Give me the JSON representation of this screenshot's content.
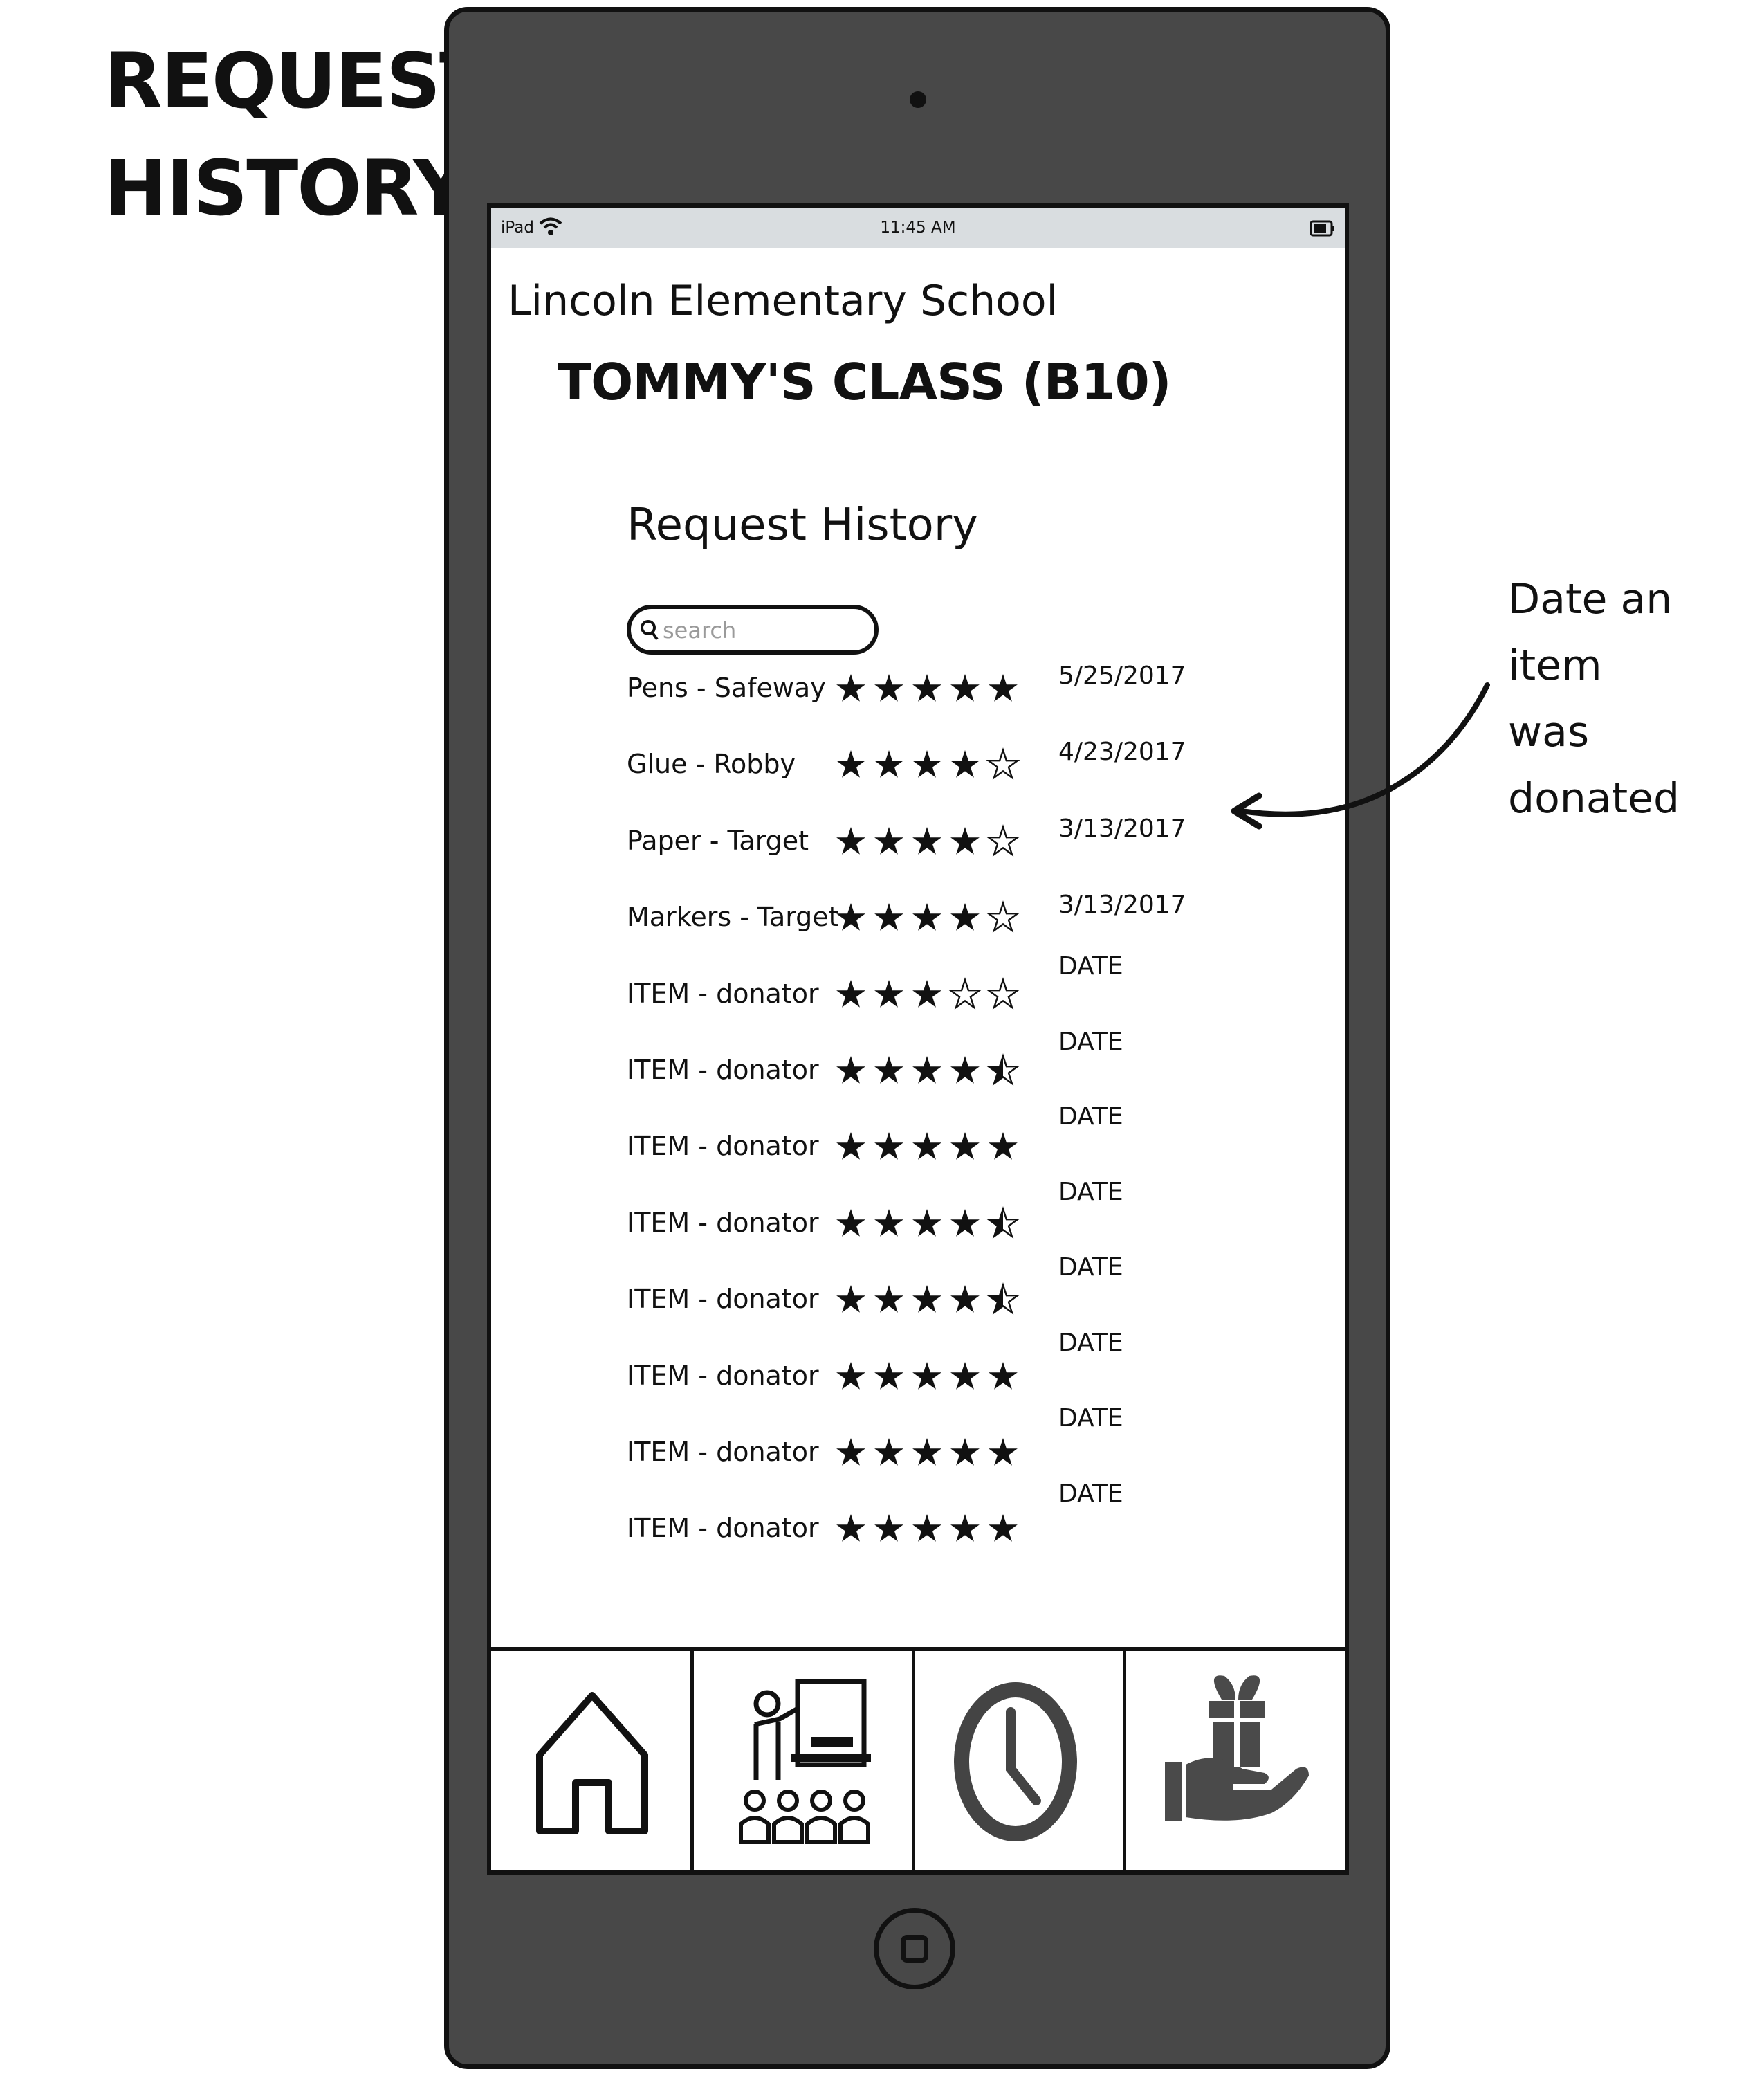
{
  "page_title": {
    "line1": "REQUEST",
    "line2": "HISTORY"
  },
  "status_bar": {
    "carrier": "iPad",
    "time": "11:45 AM"
  },
  "school_name": "Lincoln Elementary School",
  "class_name": "TOMMY'S CLASS (B10)",
  "section_title": "Request History",
  "search": {
    "placeholder": "search",
    "value": ""
  },
  "requests": [
    {
      "label": "Pens - Safeway",
      "rating": 5,
      "date": "5/25/2017"
    },
    {
      "label": "Glue - Robby",
      "rating": 4,
      "date": "4/23/2017"
    },
    {
      "label": "Paper - Target",
      "rating": 4,
      "date": "3/13/2017"
    },
    {
      "label": "Markers - Target",
      "rating": 4,
      "date": "3/13/2017"
    },
    {
      "label": "ITEM - donator",
      "rating": 3,
      "date": "DATE"
    },
    {
      "label": "ITEM - donator",
      "rating": 4.5,
      "date": "DATE"
    },
    {
      "label": "ITEM - donator",
      "rating": 5,
      "date": "DATE"
    },
    {
      "label": "ITEM - donator",
      "rating": 4.5,
      "date": "DATE"
    },
    {
      "label": "ITEM - donator",
      "rating": 4.5,
      "date": "DATE"
    },
    {
      "label": "ITEM - donator",
      "rating": 5,
      "date": "DATE"
    },
    {
      "label": "ITEM - donator",
      "rating": 5,
      "date": "DATE"
    },
    {
      "label": "ITEM - donator",
      "rating": 5,
      "date": "DATE"
    }
  ],
  "rating_max": 5,
  "tabs": [
    {
      "name": "home",
      "icon": "home-icon"
    },
    {
      "name": "class",
      "icon": "classroom-icon"
    },
    {
      "name": "history",
      "icon": "clock-icon"
    },
    {
      "name": "donate",
      "icon": "gift-hand-icon"
    }
  ],
  "annotation": {
    "line1": "Date an item",
    "line2": "was donated"
  },
  "colors": {
    "device_body": "#484848",
    "status_bar": "#d9dde0",
    "gift_icon": "#4a4a4a"
  }
}
